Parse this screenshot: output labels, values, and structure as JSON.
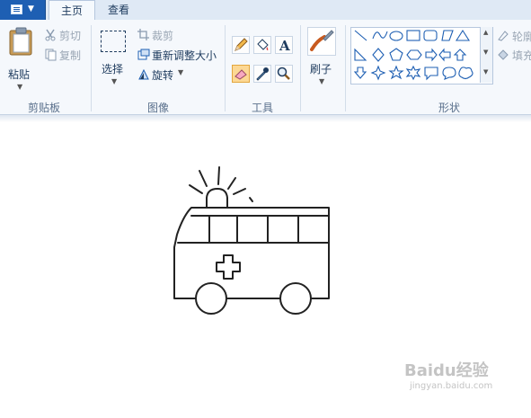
{
  "tabs": [
    "主页",
    "查看"
  ],
  "clipboard": {
    "paste": "粘贴",
    "cut": "剪切",
    "copy": "复制",
    "group": "剪贴板"
  },
  "image": {
    "select": "选择",
    "crop": "裁剪",
    "resize": "重新调整大小",
    "rotate": "旋转",
    "group": "图像"
  },
  "tools": {
    "group": "工具"
  },
  "brushes": {
    "label": "刷子"
  },
  "shapes": {
    "group": "形状",
    "outline": "轮廓",
    "fill": "填充"
  },
  "watermark": {
    "text": "Baidu经验",
    "url": "jingyan.baidu.com"
  }
}
